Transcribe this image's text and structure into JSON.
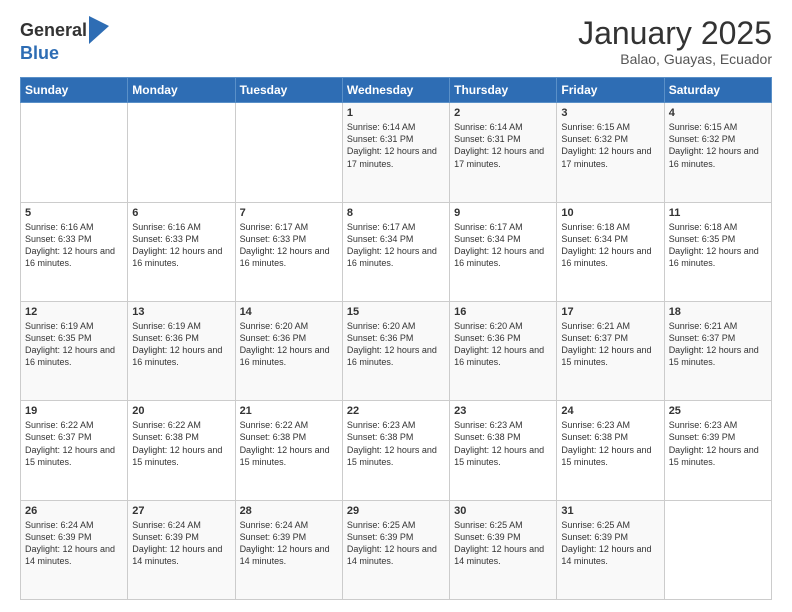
{
  "logo": {
    "general": "General",
    "blue": "Blue"
  },
  "title": {
    "month_year": "January 2025",
    "location": "Balao, Guayas, Ecuador"
  },
  "weekdays": [
    "Sunday",
    "Monday",
    "Tuesday",
    "Wednesday",
    "Thursday",
    "Friday",
    "Saturday"
  ],
  "weeks": [
    [
      {
        "day": "",
        "info": ""
      },
      {
        "day": "",
        "info": ""
      },
      {
        "day": "",
        "info": ""
      },
      {
        "day": "1",
        "info": "Sunrise: 6:14 AM\nSunset: 6:31 PM\nDaylight: 12 hours and 17 minutes."
      },
      {
        "day": "2",
        "info": "Sunrise: 6:14 AM\nSunset: 6:31 PM\nDaylight: 12 hours and 17 minutes."
      },
      {
        "day": "3",
        "info": "Sunrise: 6:15 AM\nSunset: 6:32 PM\nDaylight: 12 hours and 17 minutes."
      },
      {
        "day": "4",
        "info": "Sunrise: 6:15 AM\nSunset: 6:32 PM\nDaylight: 12 hours and 16 minutes."
      }
    ],
    [
      {
        "day": "5",
        "info": "Sunrise: 6:16 AM\nSunset: 6:33 PM\nDaylight: 12 hours and 16 minutes."
      },
      {
        "day": "6",
        "info": "Sunrise: 6:16 AM\nSunset: 6:33 PM\nDaylight: 12 hours and 16 minutes."
      },
      {
        "day": "7",
        "info": "Sunrise: 6:17 AM\nSunset: 6:33 PM\nDaylight: 12 hours and 16 minutes."
      },
      {
        "day": "8",
        "info": "Sunrise: 6:17 AM\nSunset: 6:34 PM\nDaylight: 12 hours and 16 minutes."
      },
      {
        "day": "9",
        "info": "Sunrise: 6:17 AM\nSunset: 6:34 PM\nDaylight: 12 hours and 16 minutes."
      },
      {
        "day": "10",
        "info": "Sunrise: 6:18 AM\nSunset: 6:34 PM\nDaylight: 12 hours and 16 minutes."
      },
      {
        "day": "11",
        "info": "Sunrise: 6:18 AM\nSunset: 6:35 PM\nDaylight: 12 hours and 16 minutes."
      }
    ],
    [
      {
        "day": "12",
        "info": "Sunrise: 6:19 AM\nSunset: 6:35 PM\nDaylight: 12 hours and 16 minutes."
      },
      {
        "day": "13",
        "info": "Sunrise: 6:19 AM\nSunset: 6:36 PM\nDaylight: 12 hours and 16 minutes."
      },
      {
        "day": "14",
        "info": "Sunrise: 6:20 AM\nSunset: 6:36 PM\nDaylight: 12 hours and 16 minutes."
      },
      {
        "day": "15",
        "info": "Sunrise: 6:20 AM\nSunset: 6:36 PM\nDaylight: 12 hours and 16 minutes."
      },
      {
        "day": "16",
        "info": "Sunrise: 6:20 AM\nSunset: 6:36 PM\nDaylight: 12 hours and 16 minutes."
      },
      {
        "day": "17",
        "info": "Sunrise: 6:21 AM\nSunset: 6:37 PM\nDaylight: 12 hours and 15 minutes."
      },
      {
        "day": "18",
        "info": "Sunrise: 6:21 AM\nSunset: 6:37 PM\nDaylight: 12 hours and 15 minutes."
      }
    ],
    [
      {
        "day": "19",
        "info": "Sunrise: 6:22 AM\nSunset: 6:37 PM\nDaylight: 12 hours and 15 minutes."
      },
      {
        "day": "20",
        "info": "Sunrise: 6:22 AM\nSunset: 6:38 PM\nDaylight: 12 hours and 15 minutes."
      },
      {
        "day": "21",
        "info": "Sunrise: 6:22 AM\nSunset: 6:38 PM\nDaylight: 12 hours and 15 minutes."
      },
      {
        "day": "22",
        "info": "Sunrise: 6:23 AM\nSunset: 6:38 PM\nDaylight: 12 hours and 15 minutes."
      },
      {
        "day": "23",
        "info": "Sunrise: 6:23 AM\nSunset: 6:38 PM\nDaylight: 12 hours and 15 minutes."
      },
      {
        "day": "24",
        "info": "Sunrise: 6:23 AM\nSunset: 6:38 PM\nDaylight: 12 hours and 15 minutes."
      },
      {
        "day": "25",
        "info": "Sunrise: 6:23 AM\nSunset: 6:39 PM\nDaylight: 12 hours and 15 minutes."
      }
    ],
    [
      {
        "day": "26",
        "info": "Sunrise: 6:24 AM\nSunset: 6:39 PM\nDaylight: 12 hours and 14 minutes."
      },
      {
        "day": "27",
        "info": "Sunrise: 6:24 AM\nSunset: 6:39 PM\nDaylight: 12 hours and 14 minutes."
      },
      {
        "day": "28",
        "info": "Sunrise: 6:24 AM\nSunset: 6:39 PM\nDaylight: 12 hours and 14 minutes."
      },
      {
        "day": "29",
        "info": "Sunrise: 6:25 AM\nSunset: 6:39 PM\nDaylight: 12 hours and 14 minutes."
      },
      {
        "day": "30",
        "info": "Sunrise: 6:25 AM\nSunset: 6:39 PM\nDaylight: 12 hours and 14 minutes."
      },
      {
        "day": "31",
        "info": "Sunrise: 6:25 AM\nSunset: 6:39 PM\nDaylight: 12 hours and 14 minutes."
      },
      {
        "day": "",
        "info": ""
      }
    ]
  ]
}
